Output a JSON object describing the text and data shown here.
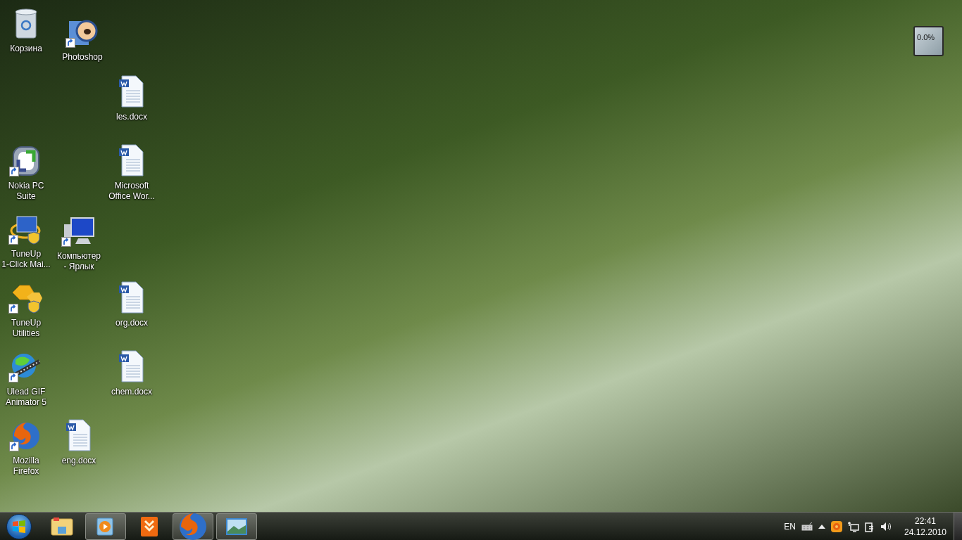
{
  "desktop_icons": [
    {
      "kind": "recycle_bin",
      "label": "Корзина",
      "shortcut": false
    },
    {
      "kind": "photoshop",
      "label": "Photoshop",
      "shortcut": true
    },
    {
      "kind": "document",
      "label": "les.docx",
      "shortcut": false
    },
    {
      "kind": "nokia",
      "label": "Nokia PC\nSuite",
      "shortcut": true
    },
    {
      "kind": "document",
      "label": "Microsoft\nOffice Wor...",
      "shortcut": false
    },
    {
      "kind": "tuneup",
      "label": "TuneUp\n1-Click Mai...",
      "shortcut": true
    },
    {
      "kind": "computer",
      "label": "Компьютер\n- Ярлык",
      "shortcut": true
    },
    {
      "kind": "tuneup_utilities",
      "label": "TuneUp\nUtilities",
      "shortcut": true
    },
    {
      "kind": "document",
      "label": "org.docx",
      "shortcut": false
    },
    {
      "kind": "gif_animator",
      "label": "Ulead GIF\nAnimator 5",
      "shortcut": true
    },
    {
      "kind": "document",
      "label": "chem.docx",
      "shortcut": false
    },
    {
      "kind": "firefox",
      "label": "Mozilla\nFirefox",
      "shortcut": true
    },
    {
      "kind": "document",
      "label": "eng.docx",
      "shortcut": false
    }
  ],
  "gadget": {
    "reading": "0.0%"
  },
  "taskbar": {
    "pinned": [
      {
        "kind": "explorer",
        "running": false
      },
      {
        "kind": "media_player",
        "running": true
      },
      {
        "kind": "downloader",
        "running": false
      },
      {
        "kind": "firefox",
        "running": true
      },
      {
        "kind": "photo_viewer",
        "running": true
      }
    ],
    "tray": {
      "language": "EN",
      "time": "22:41",
      "date": "24.12.2010"
    }
  }
}
